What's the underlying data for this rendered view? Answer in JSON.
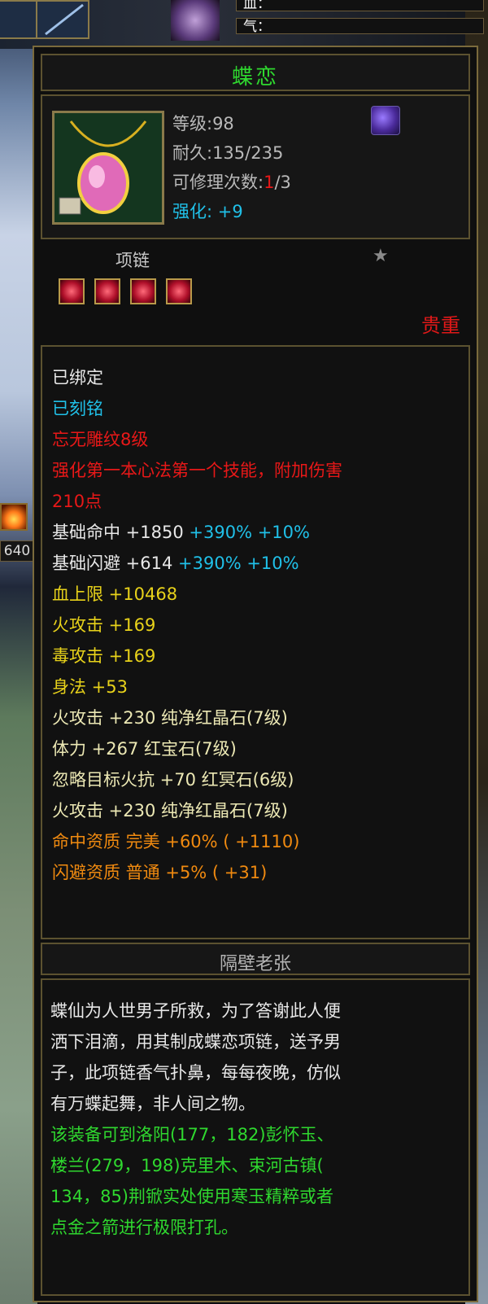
{
  "hud": {
    "energy_label": "气：",
    "partial_label": "血：",
    "level_number": "640"
  },
  "item": {
    "name": "蝶恋",
    "level": "等级:98",
    "durability": "耐久:135/235",
    "repair_prefix": "可修理次数:",
    "repair_used": "1",
    "repair_total": "/3",
    "enhance_label": "强化:",
    "enhance_value": "+9",
    "type": "项链",
    "rarity": "贵重",
    "gem_count": 4
  },
  "attributes": [
    {
      "text": "已绑定",
      "color": "#e8e8e8"
    },
    {
      "text": "已刻铭",
      "color": "#20c0e8"
    },
    {
      "text": "忘无雕纹8级",
      "color": "#e81818"
    },
    {
      "text": "强化第一本心法第一个技能，附加伤害",
      "color": "#e81818"
    },
    {
      "text": "210点",
      "color": "#e81818"
    },
    {
      "parts": [
        {
          "text": "基础命中  +1850  ",
          "color": "#e8e8e8"
        },
        {
          "text": "+390% +10%",
          "color": "#20c0e8"
        }
      ]
    },
    {
      "parts": [
        {
          "text": "基础闪避  +614  ",
          "color": "#e8e8e8"
        },
        {
          "text": "+390% +10%",
          "color": "#20c0e8"
        }
      ]
    },
    {
      "text": "血上限  +10468",
      "color": "#e8d21a"
    },
    {
      "text": "火攻击  +169",
      "color": "#e8d21a"
    },
    {
      "text": "毒攻击  +169",
      "color": "#e8d21a"
    },
    {
      "text": "身法  +53",
      "color": "#e8d21a"
    },
    {
      "text": "火攻击  +230  纯净红晶石(7级)",
      "color": "#ece8b4"
    },
    {
      "text": "体力  +267  红宝石(7级)",
      "color": "#ece8b4"
    },
    {
      "text": "忽略目标火抗  +70  红冥石(6级)",
      "color": "#ece8b4"
    },
    {
      "text": "火攻击  +230  纯净红晶石(7级)",
      "color": "#ece8b4"
    },
    {
      "text": "命中资质    完美  +60% ( +1110)",
      "color": "#f08a10"
    },
    {
      "text": "闪避资质    普通  +5% ( +31)",
      "color": "#f08a10"
    }
  ],
  "owner": "隔壁老张",
  "description": [
    {
      "text": "蝶仙为人世男子所救，为了答谢此人便",
      "color": "#e8e8e8"
    },
    {
      "text": "洒下泪滴，用其制成蝶恋项链，送予男",
      "color": "#e8e8e8"
    },
    {
      "text": "子，此项链香气扑鼻，每每夜晚，仿似",
      "color": "#e8e8e8"
    },
    {
      "text": "有万蝶起舞，非人间之物。",
      "color": "#e8e8e8"
    },
    {
      "text": "该装备可到洛阳(177，182)彭怀玉、",
      "color": "#2fd82f"
    },
    {
      "text": "楼兰(279，198)克里木、束河古镇(",
      "color": "#2fd82f"
    },
    {
      "text": "134，85)荆锨实处使用寒玉精粹或者",
      "color": "#2fd82f"
    },
    {
      "text": "点金之箭进行极限打孔。",
      "color": "#2fd82f"
    }
  ]
}
